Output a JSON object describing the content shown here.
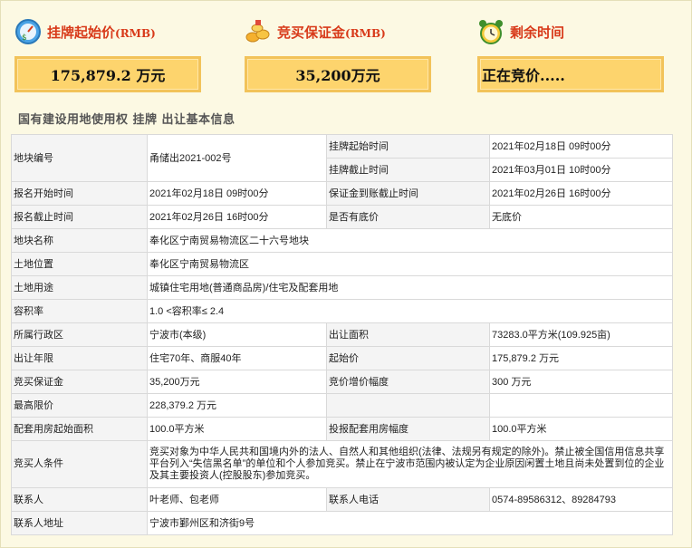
{
  "summary": {
    "start_price": {
      "title": "挂牌起始价",
      "unit": "(RMB)",
      "value": "175,879.2 万元",
      "icon": "money-gauge-icon"
    },
    "deposit": {
      "title": "竞买保证金",
      "unit": "(RMB)",
      "value": "35,200万元",
      "icon": "coins-icon"
    },
    "remaining": {
      "title": "剩余时间",
      "value": "正在竞价.....",
      "icon": "alarm-clock-icon"
    }
  },
  "section_title": "国有建设用地使用权 挂牌 出让基本信息",
  "table": {
    "parcel_no_label": "地块编号",
    "parcel_no": "甬储出2021-002号",
    "list_start_label": "挂牌起始时间",
    "list_start": "2021年02月18日 09时00分",
    "list_end_label": "挂牌截止时间",
    "list_end": "2021年03月01日 10时00分",
    "reg_start_label": "报名开始时间",
    "reg_start": "2021年02月18日 09时00分",
    "deposit_deadline_label": "保证金到账截止时间",
    "deposit_deadline": "2021年02月26日 16时00分",
    "reg_end_label": "报名截止时间",
    "reg_end": "2021年02月26日 16时00分",
    "reserve_label": "是否有底价",
    "reserve": "无底价",
    "name_label": "地块名称",
    "name": "奉化区宁南贸易物流区二十六号地块",
    "location_label": "土地位置",
    "location": "奉化区宁南贸易物流区",
    "use_label": "土地用途",
    "use": "城镇住宅用地(普通商品房)/住宅及配套用地",
    "far_label": "容积率",
    "far": "1.0 <容积率≤ 2.4",
    "district_label": "所属行政区",
    "district": "宁波市(本级)",
    "area_label": "出让面积",
    "area": "73283.0平方米(109.925亩)",
    "term_label": "出让年限",
    "term": "住宅70年、商服40年",
    "start_price_label": "起始价",
    "start_price": "175,879.2 万元",
    "bid_deposit_label": "竞买保证金",
    "bid_deposit": "35,200万元",
    "increment_label": "竞价增价幅度",
    "increment": "300 万元",
    "max_price_label": "最高限价",
    "max_price": "228,379.2 万元",
    "housing_start_label": "配套用房起始面积",
    "housing_start": "100.0平方米",
    "housing_bid_label": "投报配套用房幅度",
    "housing_bid": "100.0平方米",
    "bidder_label": "竞买人条件",
    "bidder": "竞买对象为中华人民共和国境内外的法人、自然人和其他组织(法律、法规另有规定的除外)。禁止被全国信用信息共享平台列入“失信黑名单”的单位和个人参加竞买。禁止在宁波市范围内被认定为企业原因闲置土地且尚未处置到位的企业及其主要投资人(控股股东)参加竞买。",
    "contact_label": "联系人",
    "contact": "叶老师、包老师",
    "phone_label": "联系人电话",
    "phone": "0574-89586312、89284793",
    "address_label": "联系人地址",
    "address": "宁波市鄞州区和济街9号"
  },
  "colors": {
    "accent_red": "#d83a1a",
    "box_fill": "#fdd46d",
    "page_bg": "#fcf9e3"
  }
}
